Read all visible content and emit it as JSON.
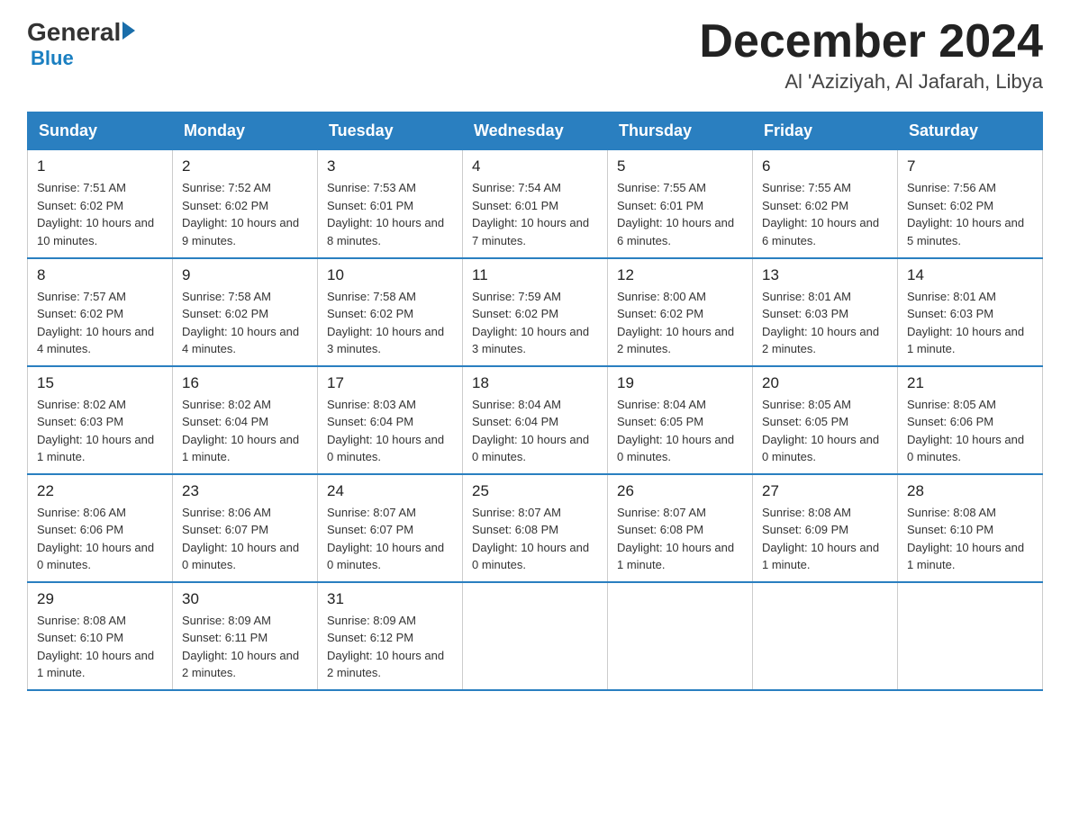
{
  "header": {
    "logo_general": "General",
    "logo_blue": "Blue",
    "month_title": "December 2024",
    "location": "Al 'Aziziyah, Al Jafarah, Libya"
  },
  "days_of_week": [
    "Sunday",
    "Monday",
    "Tuesday",
    "Wednesday",
    "Thursday",
    "Friday",
    "Saturday"
  ],
  "weeks": [
    [
      {
        "day": "1",
        "sunrise": "7:51 AM",
        "sunset": "6:02 PM",
        "daylight": "10 hours and 10 minutes."
      },
      {
        "day": "2",
        "sunrise": "7:52 AM",
        "sunset": "6:02 PM",
        "daylight": "10 hours and 9 minutes."
      },
      {
        "day": "3",
        "sunrise": "7:53 AM",
        "sunset": "6:01 PM",
        "daylight": "10 hours and 8 minutes."
      },
      {
        "day": "4",
        "sunrise": "7:54 AM",
        "sunset": "6:01 PM",
        "daylight": "10 hours and 7 minutes."
      },
      {
        "day": "5",
        "sunrise": "7:55 AM",
        "sunset": "6:01 PM",
        "daylight": "10 hours and 6 minutes."
      },
      {
        "day": "6",
        "sunrise": "7:55 AM",
        "sunset": "6:02 PM",
        "daylight": "10 hours and 6 minutes."
      },
      {
        "day": "7",
        "sunrise": "7:56 AM",
        "sunset": "6:02 PM",
        "daylight": "10 hours and 5 minutes."
      }
    ],
    [
      {
        "day": "8",
        "sunrise": "7:57 AM",
        "sunset": "6:02 PM",
        "daylight": "10 hours and 4 minutes."
      },
      {
        "day": "9",
        "sunrise": "7:58 AM",
        "sunset": "6:02 PM",
        "daylight": "10 hours and 4 minutes."
      },
      {
        "day": "10",
        "sunrise": "7:58 AM",
        "sunset": "6:02 PM",
        "daylight": "10 hours and 3 minutes."
      },
      {
        "day": "11",
        "sunrise": "7:59 AM",
        "sunset": "6:02 PM",
        "daylight": "10 hours and 3 minutes."
      },
      {
        "day": "12",
        "sunrise": "8:00 AM",
        "sunset": "6:02 PM",
        "daylight": "10 hours and 2 minutes."
      },
      {
        "day": "13",
        "sunrise": "8:01 AM",
        "sunset": "6:03 PM",
        "daylight": "10 hours and 2 minutes."
      },
      {
        "day": "14",
        "sunrise": "8:01 AM",
        "sunset": "6:03 PM",
        "daylight": "10 hours and 1 minute."
      }
    ],
    [
      {
        "day": "15",
        "sunrise": "8:02 AM",
        "sunset": "6:03 PM",
        "daylight": "10 hours and 1 minute."
      },
      {
        "day": "16",
        "sunrise": "8:02 AM",
        "sunset": "6:04 PM",
        "daylight": "10 hours and 1 minute."
      },
      {
        "day": "17",
        "sunrise": "8:03 AM",
        "sunset": "6:04 PM",
        "daylight": "10 hours and 0 minutes."
      },
      {
        "day": "18",
        "sunrise": "8:04 AM",
        "sunset": "6:04 PM",
        "daylight": "10 hours and 0 minutes."
      },
      {
        "day": "19",
        "sunrise": "8:04 AM",
        "sunset": "6:05 PM",
        "daylight": "10 hours and 0 minutes."
      },
      {
        "day": "20",
        "sunrise": "8:05 AM",
        "sunset": "6:05 PM",
        "daylight": "10 hours and 0 minutes."
      },
      {
        "day": "21",
        "sunrise": "8:05 AM",
        "sunset": "6:06 PM",
        "daylight": "10 hours and 0 minutes."
      }
    ],
    [
      {
        "day": "22",
        "sunrise": "8:06 AM",
        "sunset": "6:06 PM",
        "daylight": "10 hours and 0 minutes."
      },
      {
        "day": "23",
        "sunrise": "8:06 AM",
        "sunset": "6:07 PM",
        "daylight": "10 hours and 0 minutes."
      },
      {
        "day": "24",
        "sunrise": "8:07 AM",
        "sunset": "6:07 PM",
        "daylight": "10 hours and 0 minutes."
      },
      {
        "day": "25",
        "sunrise": "8:07 AM",
        "sunset": "6:08 PM",
        "daylight": "10 hours and 0 minutes."
      },
      {
        "day": "26",
        "sunrise": "8:07 AM",
        "sunset": "6:08 PM",
        "daylight": "10 hours and 1 minute."
      },
      {
        "day": "27",
        "sunrise": "8:08 AM",
        "sunset": "6:09 PM",
        "daylight": "10 hours and 1 minute."
      },
      {
        "day": "28",
        "sunrise": "8:08 AM",
        "sunset": "6:10 PM",
        "daylight": "10 hours and 1 minute."
      }
    ],
    [
      {
        "day": "29",
        "sunrise": "8:08 AM",
        "sunset": "6:10 PM",
        "daylight": "10 hours and 1 minute."
      },
      {
        "day": "30",
        "sunrise": "8:09 AM",
        "sunset": "6:11 PM",
        "daylight": "10 hours and 2 minutes."
      },
      {
        "day": "31",
        "sunrise": "8:09 AM",
        "sunset": "6:12 PM",
        "daylight": "10 hours and 2 minutes."
      },
      null,
      null,
      null,
      null
    ]
  ]
}
